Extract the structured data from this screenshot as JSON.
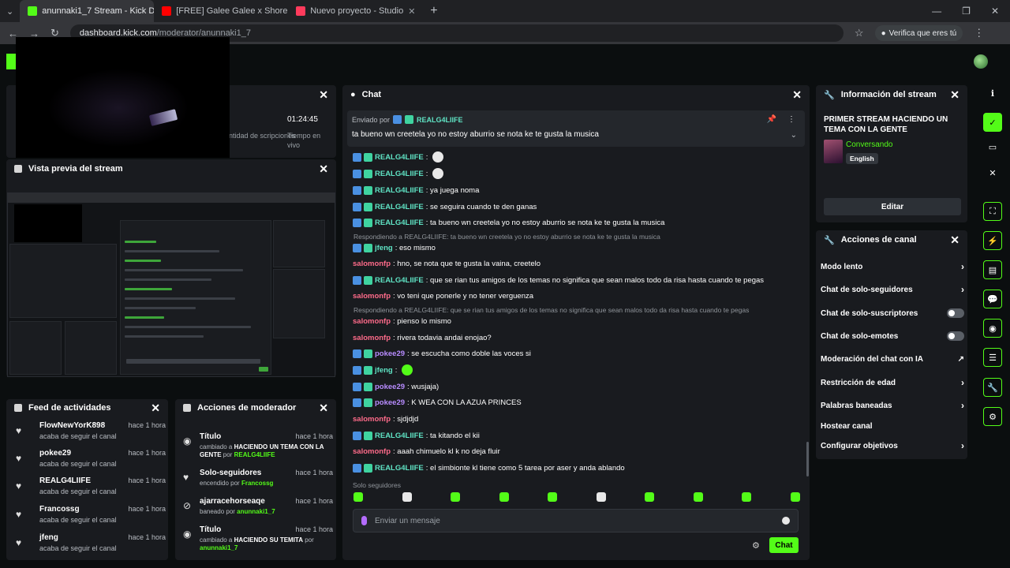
{
  "browser": {
    "tabs": [
      {
        "label": "anunnaki1_7 Stream - Kick Das",
        "color": "#53fc18"
      },
      {
        "label": "[FREE] Galee Galee x Shoreline ",
        "color": "#ff0000"
      },
      {
        "label": "Nuevo proyecto - Studio",
        "color": "#ff3b5c"
      }
    ],
    "url_host": "dashboard.kick.com",
    "url_path": "/moderator/anunnaki1_7",
    "verify_label": "Verifica que eres tú"
  },
  "stats": {
    "time": "01:24:45",
    "time_label": "Tiempo en vivo",
    "subs_label": "ntidad de scripciones"
  },
  "preview": {
    "title": "Vista previa del stream"
  },
  "feed": {
    "title": "Feed de actividades",
    "items": [
      {
        "name": "FlowNewYorK898",
        "action": "acaba de seguir el canal",
        "time": "hace 1 hora"
      },
      {
        "name": "pokee29",
        "action": "acaba de seguir el canal",
        "time": "hace 1 hora"
      },
      {
        "name": "REALG4LIIFE",
        "action": "acaba de seguir el canal",
        "time": "hace 1 hora"
      },
      {
        "name": "Francossg",
        "action": "acaba de seguir el canal",
        "time": "hace 1 hora"
      },
      {
        "name": "jfeng",
        "action": "acaba de seguir el canal",
        "time": "hace 1 hora"
      }
    ]
  },
  "mod": {
    "title": "Acciones de moderador",
    "items": [
      {
        "title": "Título",
        "prefix": "cambiado a",
        "value": "HACIENDO UN TEMA CON LA GENTE",
        "by": "por",
        "user": "REALG4LIIFE",
        "time": "hace 1 hora"
      },
      {
        "title": "Solo-seguidores",
        "prefix": "encendido por",
        "value": "",
        "by": "",
        "user": "Francossg",
        "time": "hace 1 hora"
      },
      {
        "title": "ajarracehorseaqe",
        "prefix": "baneado por",
        "value": "",
        "by": "",
        "user": "anunnaki1_7",
        "time": "hace 1 hora"
      },
      {
        "title": "Título",
        "prefix": "cambiado a",
        "value": "HACIENDO SU TEMITA",
        "by": "por",
        "user": "anunnaki1_7",
        "time": "hace 1 hora"
      }
    ]
  },
  "chat": {
    "title": "Chat",
    "pinned_by_label": "Enviado por",
    "pinned_user": "REALG4LIIFE",
    "pinned_text": "ta bueno wn creetela yo no estoy aburrio se nota ke te gusta la musica",
    "messages": [
      {
        "user": "REALG4LIIFE",
        "text": ":",
        "emoji": true
      },
      {
        "user": "REALG4LIIFE",
        "text": ":",
        "emoji": true
      },
      {
        "user": "REALG4LIIFE",
        "text": ": ya juega noma"
      },
      {
        "user": "REALG4LIIFE",
        "text": ": se seguira cuando te den ganas"
      },
      {
        "user": "REALG4LIIFE",
        "text": ": ta bueno wn creetela yo no estoy aburrio se nota ke te gusta la musica"
      },
      {
        "user": "jfeng",
        "text": ": eso mismo"
      },
      {
        "user": "salomonfp",
        "text": ": hno, se nota que te gusta la vaina, creetelo"
      },
      {
        "user": "REALG4LIIFE",
        "text": ": que se rian tus amigos de los temas no significa que sean malos todo da risa hasta cuando te pegas"
      },
      {
        "user": "salomonfp",
        "text": ": vo teni que ponerle y no tener verguenza"
      },
      {
        "user": "salomonfp",
        "text": ": pienso lo mismo"
      },
      {
        "user": "salomonfp",
        "text": ": rivera todavia andai enojao?"
      },
      {
        "user": "pokee29",
        "text": ": se escucha como doble las voces si"
      },
      {
        "user": "jfeng",
        "text": ":",
        "emoji": true
      },
      {
        "user": "pokee29",
        "text": ": wusjaja)"
      },
      {
        "user": "pokee29",
        "text": ": K WEA CON LA AZUA PRINCES"
      },
      {
        "user": "salomonfp",
        "text": ": sjdjdjd"
      },
      {
        "user": "REALG4LIIFE",
        "text": ": ta kitando el kii"
      },
      {
        "user": "salomonfp",
        "text": ": aaah chimuelo kl k no deja fluir"
      },
      {
        "user": "REALG4LIIFE",
        "text": ": el simbionte kl tiene como 5 tarea por aser y anda ablando"
      }
    ],
    "replies": [
      "Respondiendo a REALG4LIIFE: ta bueno wn creetela yo no estoy aburrio se nota ke te gusta la musica",
      "Respondiendo a REALG4LIIFE: que se rian tus amigos de los temas no significa que sean malos todo da risa hasta cuando te pegas"
    ],
    "followers_note": "Solo seguidores",
    "input_placeholder": "Enviar un mensaje",
    "send_label": "Chat"
  },
  "info": {
    "title": "Información del stream",
    "stream_title": "PRIMER STREAM HACIENDO UN TEMA CON LA GENTE",
    "category": "Conversando",
    "language": "English",
    "edit_label": "Editar"
  },
  "actions": {
    "title": "Acciones de canal",
    "items": [
      {
        "label": "Modo lento",
        "control": "chevron"
      },
      {
        "label": "Chat de solo-seguidores",
        "control": "chevron"
      },
      {
        "label": "Chat de solo-suscriptores",
        "control": "toggle"
      },
      {
        "label": "Chat de solo-emotes",
        "control": "toggle"
      },
      {
        "label": "Moderación del chat con IA",
        "control": "external"
      },
      {
        "label": "Restricción de edad",
        "control": "chevron"
      },
      {
        "label": "Palabras baneadas",
        "control": "chevron"
      },
      {
        "label": "Hostear canal",
        "control": "none"
      },
      {
        "label": "Configurar objetivos",
        "control": "chevron"
      }
    ]
  },
  "colors": {
    "accent": "#53fc18",
    "panel": "#191b1f",
    "background": "#0b0e0f"
  }
}
